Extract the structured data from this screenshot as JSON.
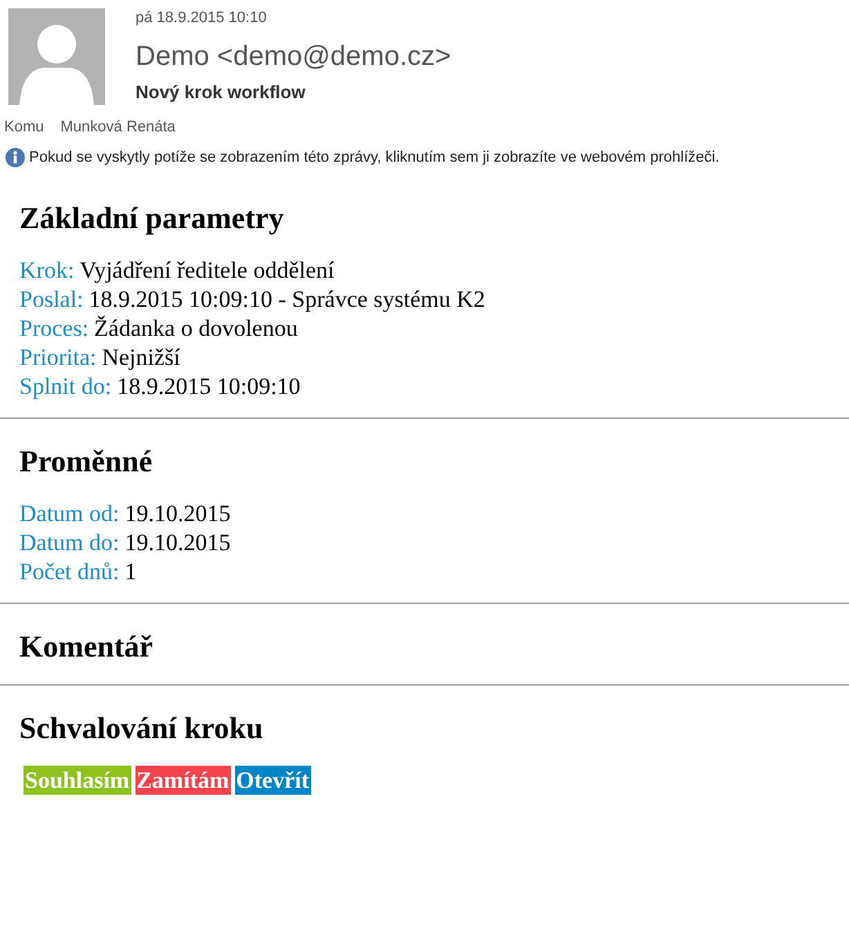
{
  "header": {
    "date": "pá 18.9.2015 10:10",
    "sender": "Demo <demo@demo.cz>",
    "subject": "Nový krok workflow",
    "to_label": "Komu",
    "to": "Munková Renáta",
    "info": "Pokud se vyskytly potíže se zobrazením této zprávy, kliknutím sem ji zobrazíte ve webovém prohlížeči."
  },
  "sections": [
    {
      "title": "Základní parametry",
      "fields": [
        {
          "label": "Krok:",
          "value": "Vyjádření ředitele oddělení"
        },
        {
          "label": "Poslal:",
          "value": "18.9.2015 10:09:10 - Správce systému K2"
        },
        {
          "label": "Proces:",
          "value": "Žádanka o dovolenou"
        },
        {
          "label": "Priorita:",
          "value": "Nejnižší"
        },
        {
          "label": "Splnit do:",
          "value": "18.9.2015 10:09:10"
        }
      ]
    },
    {
      "title": "Proměnné",
      "fields": [
        {
          "label": "Datum od:",
          "value": "19.10.2015"
        },
        {
          "label": "Datum do:",
          "value": "19.10.2015"
        },
        {
          "label": "Počet dnů:",
          "value": "1"
        }
      ]
    },
    {
      "title": "Komentář"
    },
    {
      "title": "Schvalování kroku",
      "buttons": [
        {
          "label": "Souhlasím",
          "color": "#8dc21f"
        },
        {
          "label": "Zamítám",
          "color": "#f5444d"
        },
        {
          "label": "Otevřít",
          "color": "#0085c8"
        }
      ]
    }
  ]
}
